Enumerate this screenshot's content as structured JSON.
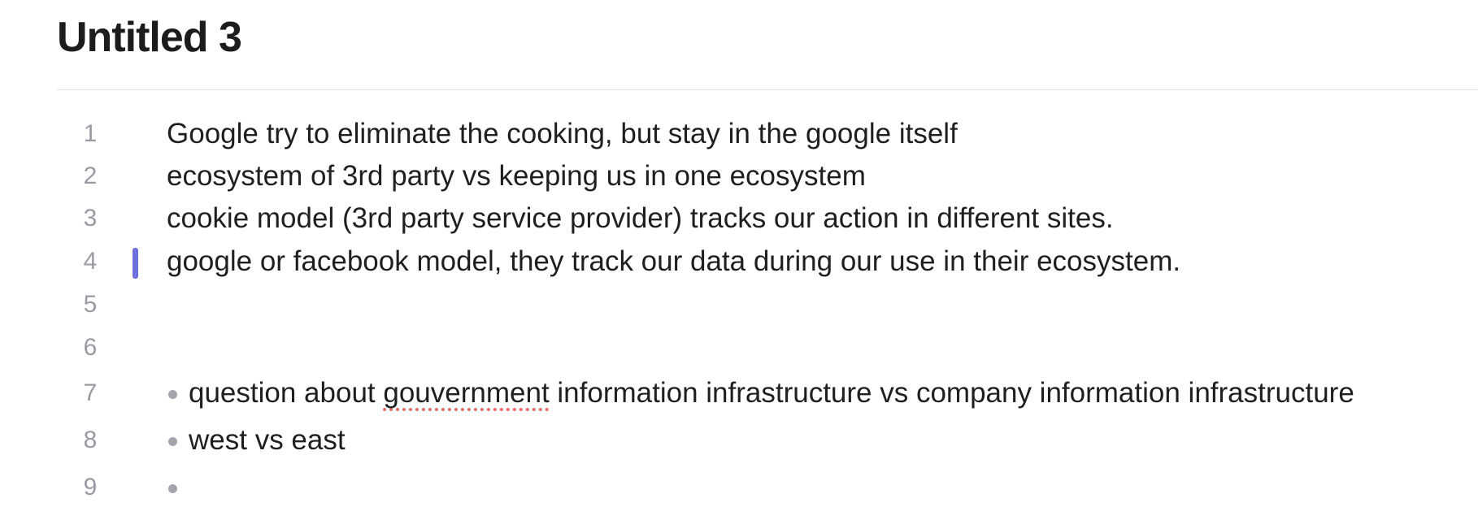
{
  "document": {
    "title": "Untitled 3"
  },
  "editor": {
    "cursor_line": 4,
    "lines": [
      {
        "number": "1",
        "text": "Google try to eliminate the cooking, but stay in the google itself"
      },
      {
        "number": "2",
        "text": "ecosystem of 3rd party vs keeping us in one ecosystem"
      },
      {
        "number": "3",
        "text": "cookie model (3rd party service provider) tracks our action in different sites."
      },
      {
        "number": "4",
        "text": "google or facebook model, they track our data during our use in their ecosystem."
      },
      {
        "number": "5",
        "text": ""
      },
      {
        "number": "6",
        "text": ""
      },
      {
        "number": "7",
        "bullet": true,
        "before": "question about ",
        "misspelled": "gouvernment",
        "after": " information infrastructure vs company information infrastructure"
      },
      {
        "number": "8",
        "bullet": true,
        "text": "west vs east"
      },
      {
        "number": "9",
        "bullet": true,
        "text": ""
      }
    ]
  },
  "colors": {
    "cursor": "#6b6fe0",
    "spellcheck": "#e46a63",
    "line_number": "#9a9aa3"
  }
}
